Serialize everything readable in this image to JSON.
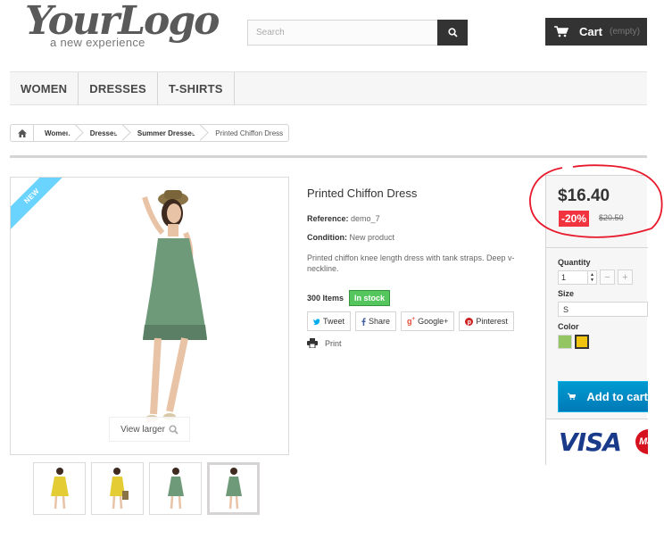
{
  "header": {
    "logo_main": "YourLogo",
    "logo_sub": "a new experience",
    "search_placeholder": "Search",
    "cart_label": "Cart",
    "cart_status": "(empty)"
  },
  "menu": {
    "items": [
      "WOMEN",
      "DRESSES",
      "T-SHIRTS"
    ]
  },
  "breadcrumb": {
    "items": [
      "Women",
      "Dresses",
      "Summer Dresses"
    ],
    "current": "Printed Chiffon Dress"
  },
  "image": {
    "badge": "NEW",
    "view_larger": "View larger"
  },
  "product": {
    "title": "Printed Chiffon Dress",
    "reference_label": "Reference:",
    "reference": "demo_7",
    "condition_label": "Condition:",
    "condition": "New product",
    "description": "Printed chiffon knee length dress with tank straps. Deep v-neckline.",
    "quantity_available": "300 Items",
    "stock_status": "In stock"
  },
  "share": {
    "tweet": "Tweet",
    "share": "Share",
    "google": "Google+",
    "pinterest": "Pinterest",
    "print": "Print"
  },
  "price": {
    "current": "$16.40",
    "reduction": "-20%",
    "old": "$20.50",
    "quantity_label": "Quantity",
    "quantity_value": "1",
    "size_label": "Size",
    "size_value": "S",
    "color_label": "Color",
    "colors": [
      "#93c663",
      "#f1c40f"
    ],
    "add_to_cart": "Add to cart",
    "card_brand": "VISA",
    "card_brand_2": "Ma"
  },
  "colors": {
    "accent_blue": "#009ad0",
    "reduction_red": "#f13340",
    "stock_green": "#55c65e",
    "annotation_red": "#e8192c"
  }
}
